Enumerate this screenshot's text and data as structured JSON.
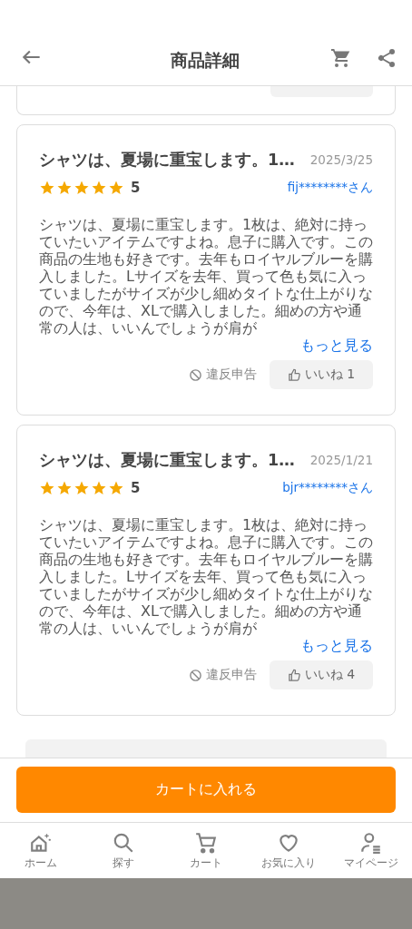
{
  "header": {
    "title": "商品詳細"
  },
  "reviews": [
    {
      "title": "シャツは、夏場に重宝します。1…",
      "date": "2025/3/25",
      "stars": 5,
      "rating": "5",
      "user": "fij********さん",
      "body": "シャツは、夏場に重宝します。1枚は、絶対に持っていたいアイテムですよね。息子に購入です。この商品の生地も好きです。去年もロイヤルブルーを購入しました。Lサイズを去年、買って色も気に入っていましたがサイズが少し細めタイトな仕上がりなので、今年は、XLで購入しました。細めの方や通常の人は、いいんでしょうが肩が",
      "more": "もっと見る",
      "report": "違反申告",
      "like": "いいね 1"
    },
    {
      "title": "シャツは、夏場に重宝します。1…",
      "date": "2025/1/21",
      "stars": 5,
      "rating": "5",
      "user": "bjr********さん",
      "body": "シャツは、夏場に重宝します。1枚は、絶対に持っていたいアイテムですよね。息子に購入です。この商品の生地も好きです。去年もロイヤルブルーを購入しました。Lサイズを去年、買って色も気に入っていましたがサイズが少し細めタイトな仕上がりなので、今年は、XLで購入しました。細めの方や通常の人は、いいんでしょうが肩が",
      "more": "もっと見る",
      "report": "違反申告",
      "like": "いいね 4"
    }
  ],
  "cart_button": "カートに入れる",
  "tab_bar": [
    {
      "kind": "home",
      "label": "ホーム"
    },
    {
      "kind": "search",
      "label": "探す"
    },
    {
      "kind": "cart",
      "label": "カート"
    },
    {
      "kind": "favorite",
      "label": "お気に入り"
    },
    {
      "kind": "mypage",
      "label": "マイページ"
    }
  ]
}
